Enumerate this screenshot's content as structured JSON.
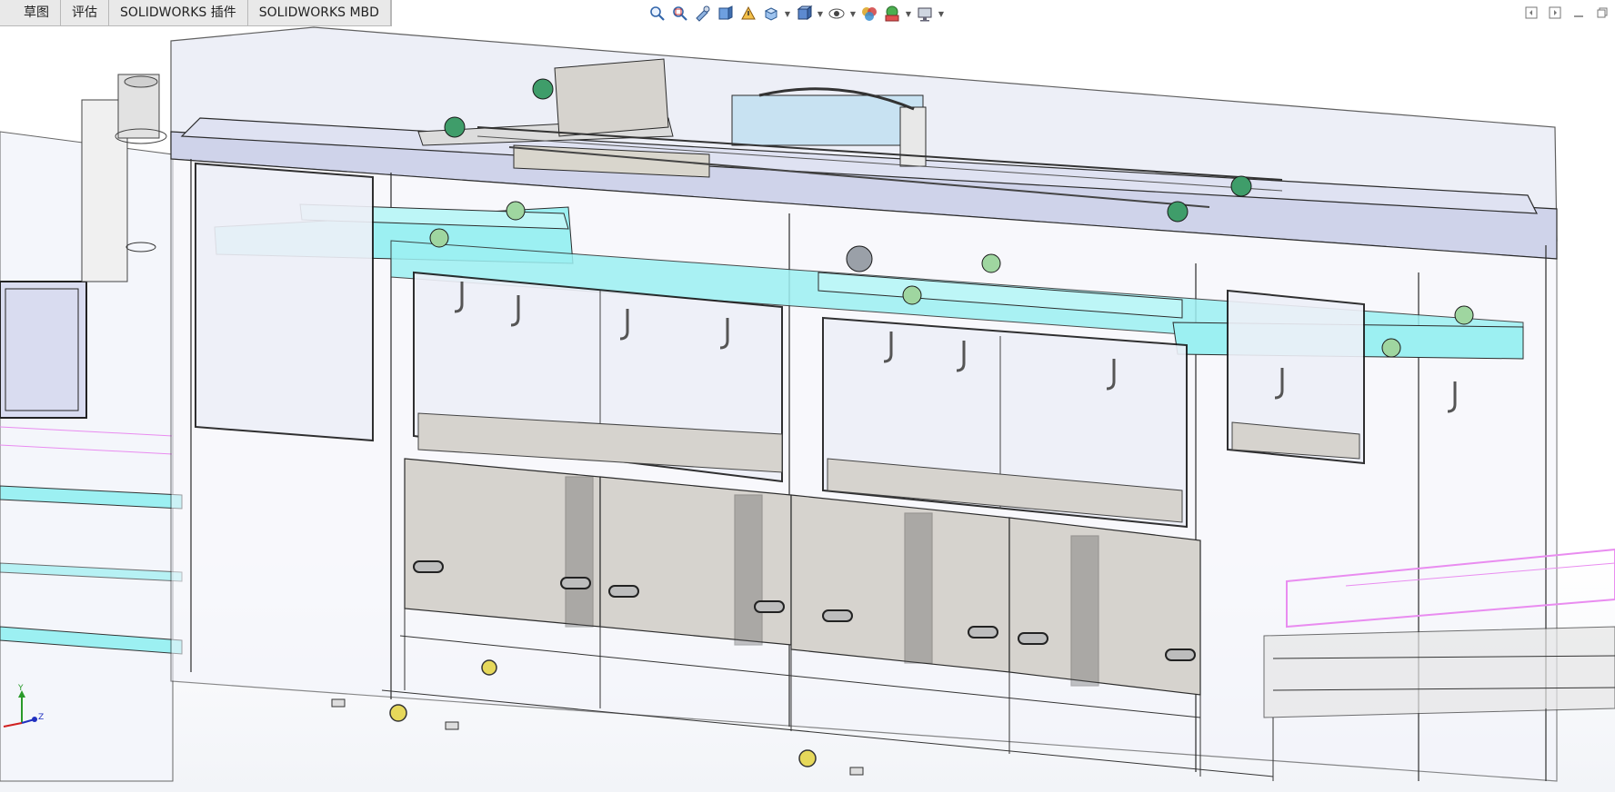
{
  "tabs": [
    {
      "label": "草图"
    },
    {
      "label": "评估"
    },
    {
      "label": "SOLIDWORKS 插件"
    },
    {
      "label": "SOLIDWORKS MBD"
    }
  ],
  "heads_up_toolbar": [
    {
      "icon": "zoom-to-fit-icon"
    },
    {
      "icon": "zoom-to-area-icon"
    },
    {
      "icon": "previous-view-icon"
    },
    {
      "icon": "section-view-icon"
    },
    {
      "icon": "dynamic-annotation-icon"
    },
    {
      "icon": "view-orientation-icon"
    },
    {
      "icon": "display-style-icon"
    },
    {
      "icon": "hide-show-items-icon"
    },
    {
      "icon": "edit-appearance-icon"
    },
    {
      "icon": "apply-scene-icon"
    },
    {
      "icon": "view-settings-icon"
    }
  ],
  "triad": {
    "x": "X",
    "y": "Y",
    "z": "Z"
  },
  "colors": {
    "frame_line": "#2b2b2b",
    "glass_fill": "#dfe2f2",
    "cyan_frame": "#9cf0f2",
    "tank_fill": "#d6d3ce",
    "magenta_rack": "#e98cf0",
    "bearing_green": "#3f9d6a"
  }
}
